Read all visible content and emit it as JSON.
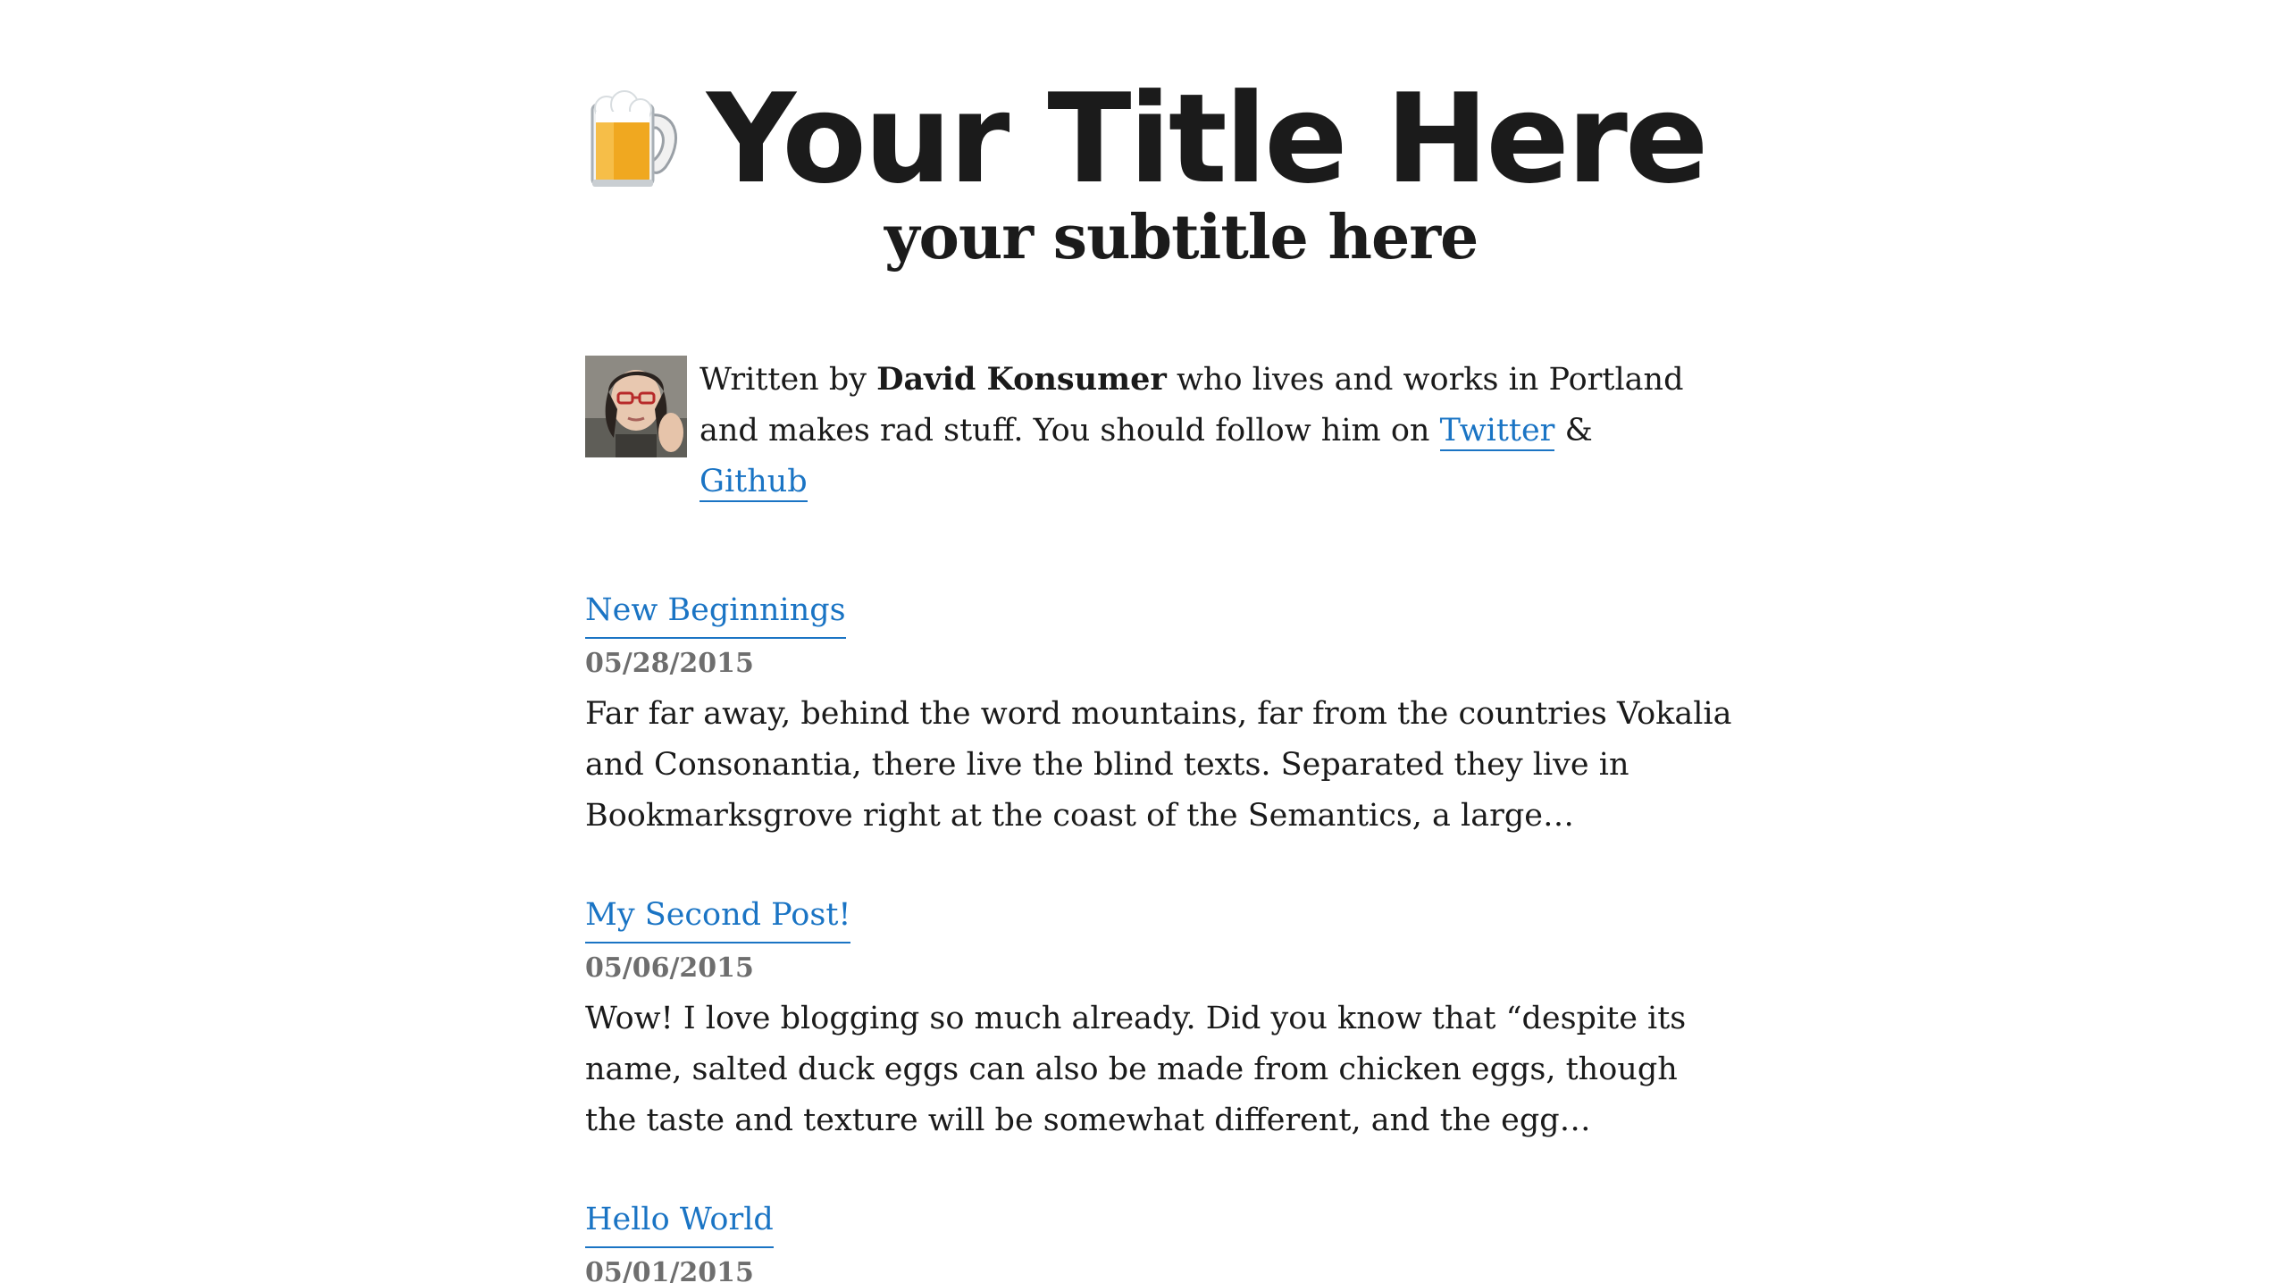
{
  "header": {
    "title": "Your Title Here",
    "subtitle": "your subtitle here",
    "logo_icon": "beer-mug-icon"
  },
  "author": {
    "prefix": "Written by",
    "name": "David Konsumer",
    "middle": "who lives and works in Portland and makes rad stuff. You should follow him on",
    "twitter_label": "Twitter",
    "amp": "&",
    "github_label": "Github",
    "avatar_icon": "author-avatar"
  },
  "colors": {
    "link": "#1a74c4",
    "date": "#6e6e6e",
    "text": "#1a1a1a"
  },
  "posts": [
    {
      "title": "New Beginnings",
      "date": "05/28/2015",
      "excerpt": "Far far away, behind the word mountains, far from the countries Vokalia and Consonantia, there live the blind texts. Separated they live in Bookmarksgrove right at the coast of the Semantics, a large…"
    },
    {
      "title": "My Second Post!",
      "date": "05/06/2015",
      "excerpt": "Wow! I love blogging so much already. Did you know that “despite its name, salted duck eggs can also be made from chicken eggs, though the taste and texture will be somewhat different, and the egg…"
    },
    {
      "title": "Hello World",
      "date": "05/01/2015",
      "excerpt": ""
    }
  ]
}
